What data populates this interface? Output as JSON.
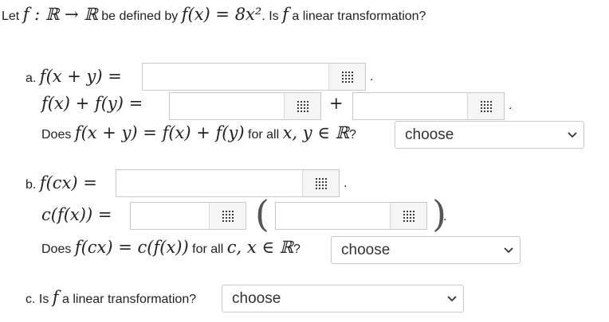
{
  "question": {
    "w1": "Let",
    "m1": "f : ℝ → ℝ",
    "w2": "be defined by",
    "m2": "f(x) = 8x²",
    "w3": ". Is",
    "m3": "f",
    "w4": "a linear transformation?"
  },
  "part_a": {
    "label": "a.",
    "lhs1": "f(x + y) =",
    "lhs2": "f(x) + f(y) =",
    "plus": "+",
    "q_pre": "Does",
    "q_math": "f(x + y) = f(x) + f(y)",
    "q_mid": "for all",
    "q_vars": "x, y ∈ ℝ",
    "q_end": "?",
    "select_value": "choose"
  },
  "part_b": {
    "label": "b.",
    "lhs1": "f(cx) =",
    "lhs2": "c(f(x)) =",
    "q_pre": "Does",
    "q_math": "f(cx) = c(f(x))",
    "q_mid": "for all",
    "q_vars": "c, x ∈ ℝ",
    "q_end": "?",
    "select_value": "choose"
  },
  "part_c": {
    "label": "c. Is",
    "m": "f",
    "text": "a linear transformation?",
    "select_value": "choose"
  },
  "icons": {
    "keypad": "grid-keypad-icon",
    "dropdown": "chevron-down-icon"
  },
  "colors": {
    "border": "#c8c8c8",
    "text": "#222222"
  }
}
